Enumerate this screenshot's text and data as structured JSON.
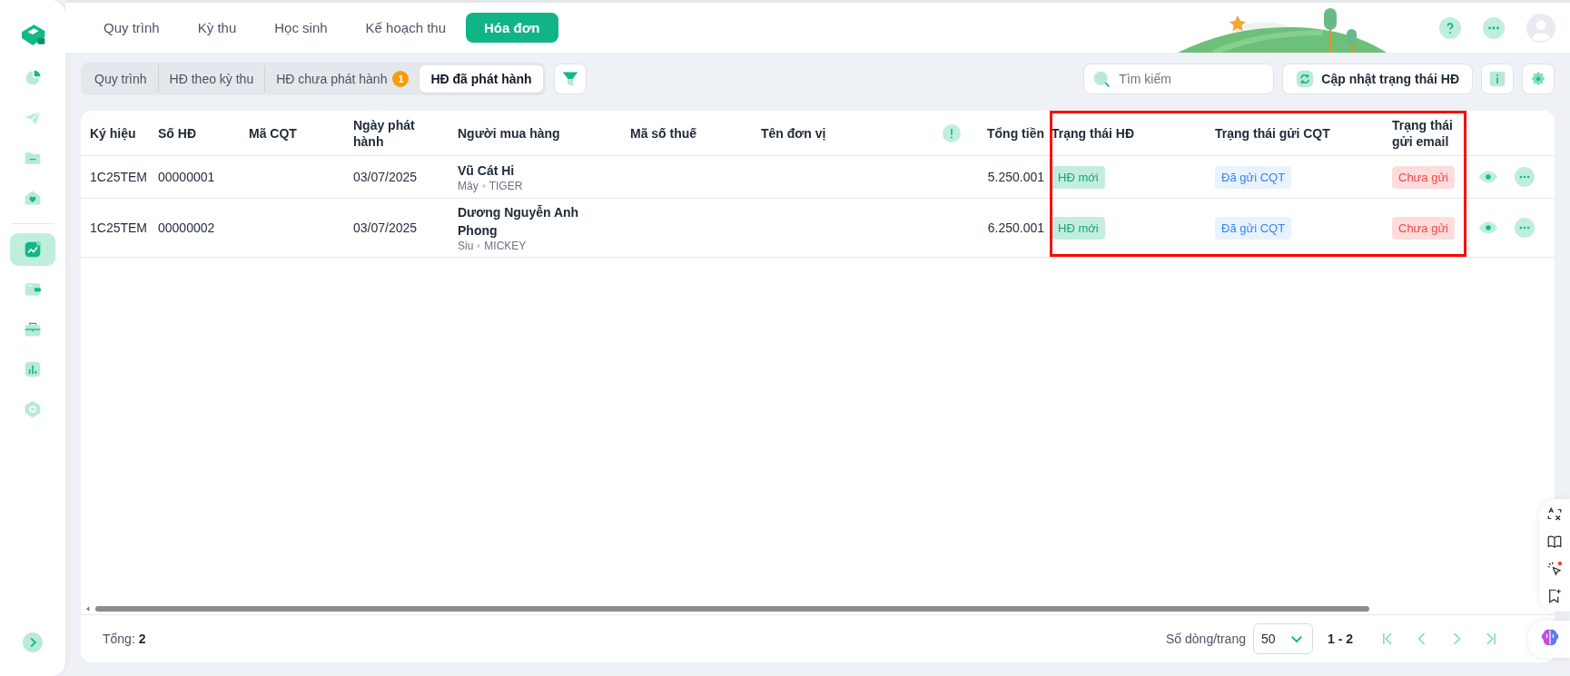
{
  "sidebar": {
    "items": [
      {
        "selected": false
      },
      {
        "selected": false
      },
      {
        "selected": false
      },
      {
        "selected": false
      },
      {
        "selected": true
      },
      {
        "selected": false
      },
      {
        "selected": false
      },
      {
        "selected": false
      },
      {
        "selected": false
      }
    ]
  },
  "top_nav": {
    "tabs": [
      {
        "label": "Quy trình",
        "selected": false
      },
      {
        "label": "Kỳ thu",
        "selected": false
      },
      {
        "label": "Học sinh",
        "selected": false
      },
      {
        "label": "Kế hoạch thu",
        "selected": false
      },
      {
        "label": "Hóa đơn",
        "selected": true
      }
    ]
  },
  "sub_tabs": [
    {
      "label": "Quy trình",
      "selected": false
    },
    {
      "label": "HĐ theo kỳ thu",
      "selected": false
    },
    {
      "label": "HĐ chưa phát hành",
      "selected": false,
      "badge": "1"
    },
    {
      "label": "HĐ đã phát hành",
      "selected": true
    }
  ],
  "search": {
    "placeholder": "Tìm kiếm"
  },
  "update_button": "Cập nhật trạng thái HĐ",
  "table": {
    "columns": [
      "Ký hiệu",
      "Số HĐ",
      "Mã CQT",
      "Ngày phát hành",
      "Người mua hàng",
      "Mã số thuế",
      "Tên đơn vị",
      "Tổng tiền",
      "Trạng thái HĐ",
      "Trạng thái gửi CQT",
      "Trạng thái gửi email"
    ],
    "rows": [
      {
        "symbol": "1C25TEM",
        "number": "00000001",
        "date": "03/07/2025",
        "buyer": "Vũ Cát Hi",
        "buyer_detail": [
          "Mây",
          "TIGER"
        ],
        "total": "5.250.001",
        "invoice_status": "HĐ mới",
        "tax_status": "Đã gửi CQT",
        "email_status": "Chưa gửi"
      },
      {
        "symbol": "1C25TEM",
        "number": "00000002",
        "date": "03/07/2025",
        "buyer": "Dương Nguyễn Anh Phong",
        "buyer_detail": [
          "Siu",
          "MICKEY"
        ],
        "total": "6.250.001",
        "invoice_status": "HĐ mới",
        "tax_status": "Đã gửi CQT",
        "email_status": "Chưa gửi"
      }
    ]
  },
  "highlight_frame": true,
  "footer": {
    "total_label": "Tổng:",
    "total_value": "2",
    "rows_per_page_label": "Số dòng/trang",
    "rows_per_page": "50",
    "range": "1 - 2"
  }
}
